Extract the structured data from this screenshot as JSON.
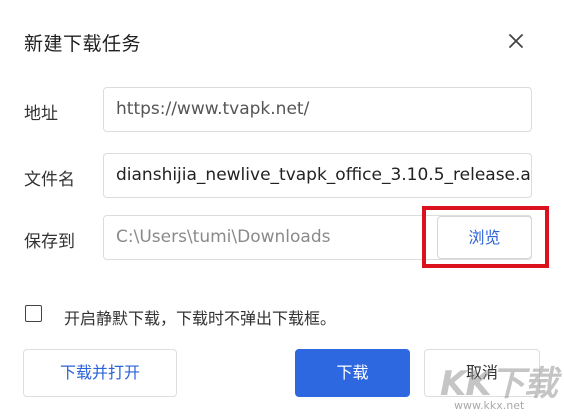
{
  "dialog": {
    "title": "新建下载任务",
    "close_icon": "close-icon"
  },
  "fields": {
    "address": {
      "label": "地址",
      "value": "https://www.tvapk.net/"
    },
    "filename": {
      "label": "文件名",
      "value": "dianshijia_newlive_tvapk_office_3.10.5_release.a|"
    },
    "save_to": {
      "label": "保存到",
      "value": "C:\\Users\\tumi\\Downloads",
      "browse_label": "浏览"
    }
  },
  "silent_download": {
    "checked": false,
    "label": "开启静默下载，下载时不弹出下载框。"
  },
  "buttons": {
    "download_and_open": "下载并打开",
    "download": "下载",
    "cancel": "取消"
  },
  "watermark": {
    "main": "KK下载",
    "url": "www.kkx.net"
  },
  "colors": {
    "accent": "#2e68e0",
    "link": "#2b63d8",
    "highlight_box": "#d9121e"
  }
}
